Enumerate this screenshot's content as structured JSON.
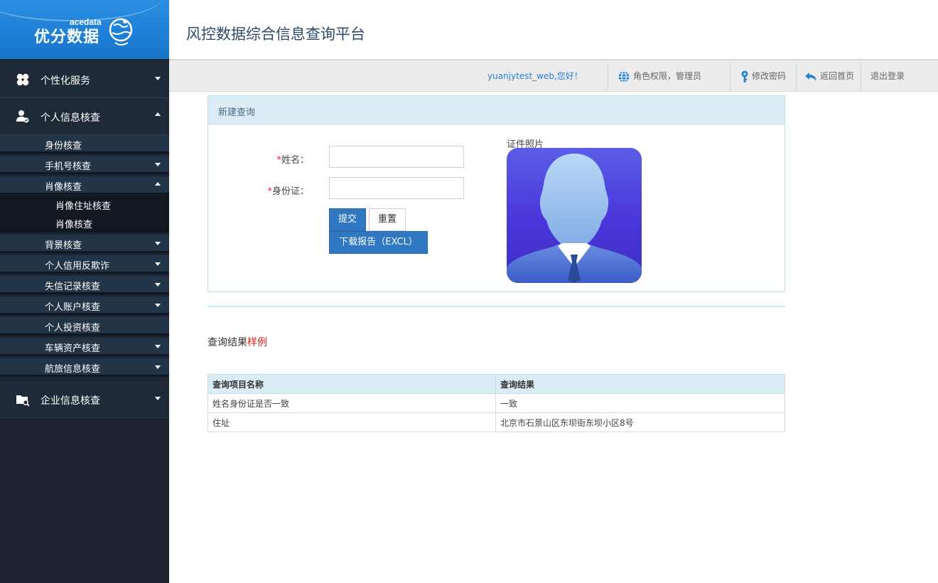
{
  "logo": {
    "small": "acedata",
    "brand": "优分数据"
  },
  "header": {
    "title": "风控数据综合信息查询平台"
  },
  "topbar": {
    "greeting": "yuanjytest_web,您好！",
    "role": "角色权限，管理员",
    "change_password": "修改密码",
    "back_home": "返回首页",
    "logout": "退出登录"
  },
  "sidebar": {
    "sections": [
      {
        "label": "个性化服务",
        "icon": "clover-icon",
        "expanded": false
      },
      {
        "label": "个人信息核查",
        "icon": "user-check-icon",
        "expanded": true
      },
      {
        "label": "企业信息核查",
        "icon": "folder-search-icon",
        "expanded": false
      }
    ],
    "personal_items": [
      {
        "label": "身份核查",
        "caret": "none"
      },
      {
        "label": "手机号核查",
        "caret": "down"
      },
      {
        "label": "肖像核查",
        "caret": "up"
      },
      {
        "label": "背景核查",
        "caret": "down"
      },
      {
        "label": "个人信用反欺诈",
        "caret": "down"
      },
      {
        "label": "失信记录核查",
        "caret": "down"
      },
      {
        "label": "个人账户核查",
        "caret": "down"
      },
      {
        "label": "个人投资核查",
        "caret": "none"
      },
      {
        "label": "车辆资产核查",
        "caret": "down"
      },
      {
        "label": "航旅信息核查",
        "caret": "down"
      }
    ],
    "portrait_items": [
      {
        "label": "肖像住址核查"
      },
      {
        "label": "肖像核查"
      }
    ]
  },
  "panel": {
    "title": "新建查询",
    "name_label": "姓名：",
    "id_label": "身份证：",
    "required_mark": "*",
    "name_value": "",
    "id_value": "",
    "submit": "提交",
    "reset": "重置",
    "download": "下载报告（EXCL）",
    "photo_label": "证件照片"
  },
  "result": {
    "title": "查询结果",
    "title_highlight": "样例",
    "columns": [
      "查询项目名称",
      "查询结果"
    ],
    "rows": [
      [
        "姓名身份证是否一致",
        "一致"
      ],
      [
        "住址",
        "北京市石景山区东坝街东坝小区8号"
      ]
    ]
  },
  "colors": {
    "sidebar_bg": "#1b2430",
    "brand_blue": "#1d7fd6",
    "button_primary": "#2f77c0",
    "highlight_red": "#e01b1b"
  }
}
